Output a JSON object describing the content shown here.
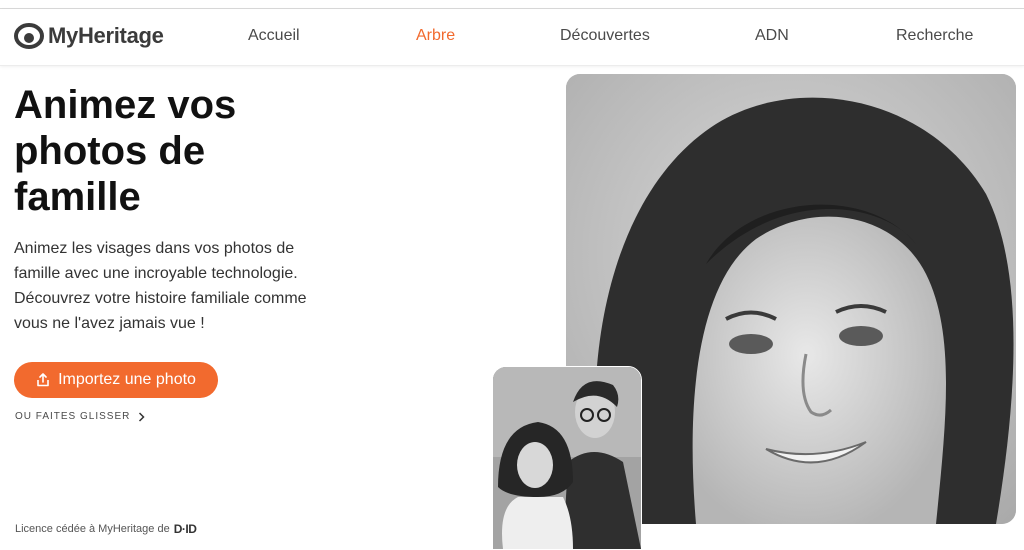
{
  "brand": {
    "name": "MyHeritage",
    "accent": "#f26a2e"
  },
  "nav": [
    {
      "label": "Accueil",
      "active": false
    },
    {
      "label": "Arbre",
      "active": true
    },
    {
      "label": "Découvertes",
      "active": false
    },
    {
      "label": "ADN",
      "active": false
    },
    {
      "label": "Recherche",
      "active": false
    }
  ],
  "hero": {
    "title": "Animez vos photos de famille",
    "description": "Animez les visages dans vos photos de famille avec une incroyable technologie. Découvrez votre histoire familiale comme vous ne l'avez jamais vue !",
    "upload_label": "Importez une photo",
    "upload_icon": "upload-icon",
    "drag_label": "OU FAITES GLISSER",
    "drag_icon": "chevron-right-icon"
  },
  "license": {
    "text": "Licence cédée à MyHeritage de",
    "partner": "D·ID"
  },
  "photos": {
    "main": "black-and-white portrait of a smiling woman",
    "thumbnail": "black-and-white photo of a couple"
  }
}
